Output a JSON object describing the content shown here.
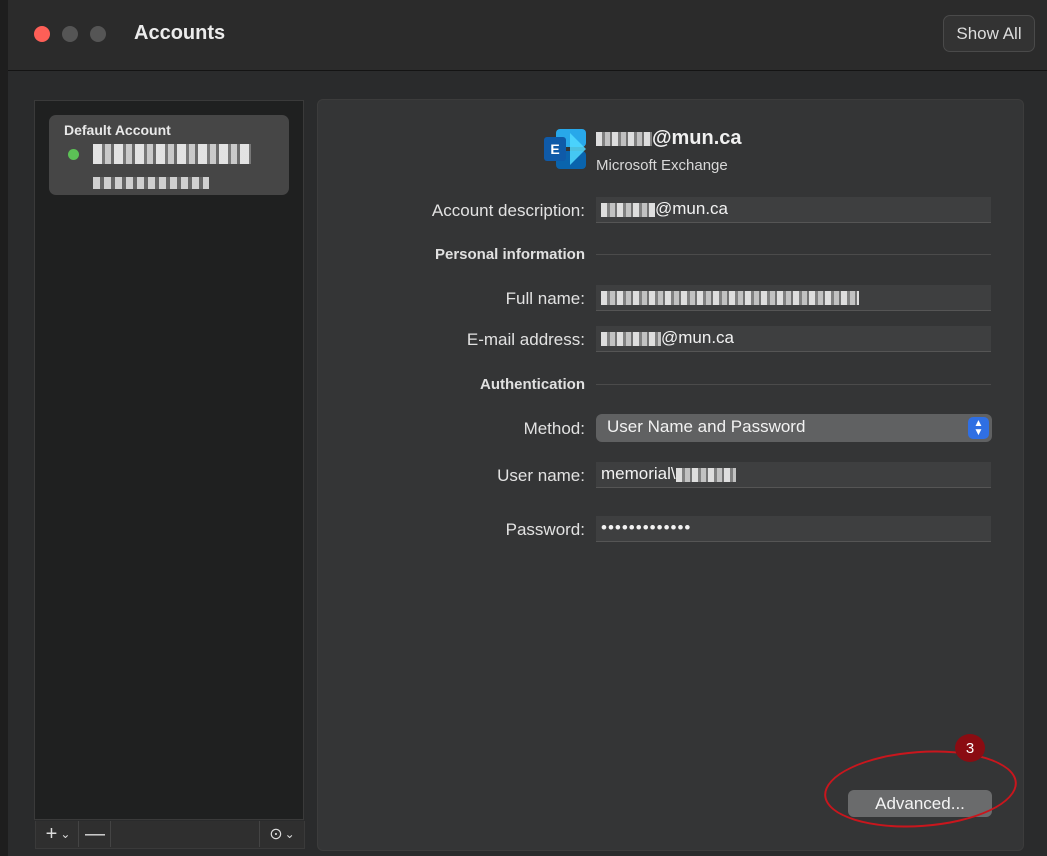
{
  "window": {
    "title": "Accounts",
    "show_all_label": "Show All"
  },
  "sidebar": {
    "account_heading": "Default Account",
    "status_color": "#5cc156",
    "toolbar": {
      "add_label": "+",
      "add_menu_icon": "chevron-down-icon",
      "remove_label": "—",
      "more_icon": "ellipsis-circle-icon"
    }
  },
  "account": {
    "email_display": "@mun.ca",
    "type": "Microsoft Exchange",
    "icon": "microsoft-exchange-icon"
  },
  "form": {
    "account_description": {
      "label": "Account description:",
      "value": "@mun.ca"
    },
    "personal_section": "Personal information",
    "full_name": {
      "label": "Full name:",
      "value": ""
    },
    "email": {
      "label": "E-mail address:",
      "value": "@mun.ca"
    },
    "auth_section": "Authentication",
    "method": {
      "label": "Method:",
      "value": "User Name and Password"
    },
    "username": {
      "label": "User name:",
      "value": "memorial\\"
    },
    "password": {
      "label": "Password:",
      "value": "•••••••••••••"
    },
    "advanced_label": "Advanced..."
  },
  "annotation": {
    "badge": "3",
    "color": "#c9161d"
  }
}
